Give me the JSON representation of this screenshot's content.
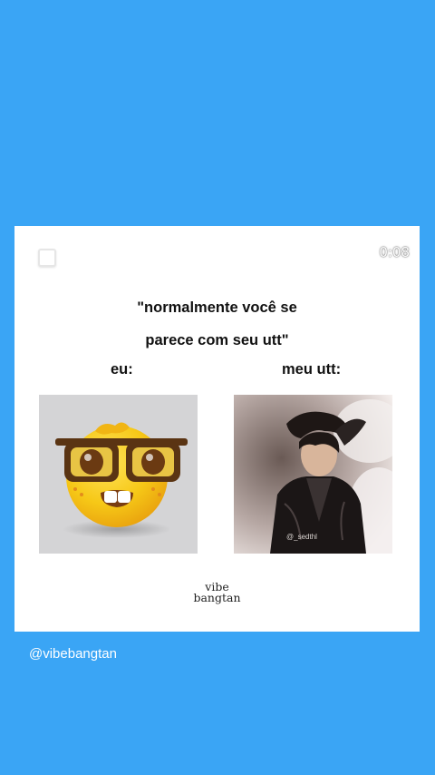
{
  "story": {
    "timer": "0:08",
    "handle": "@vibebangtan"
  },
  "post": {
    "quote_line1": "\"normalmente você se",
    "quote_line2": "parece com seu utt\"",
    "left_label": "eu:",
    "right_label": "meu utt:",
    "brand_line1": "vibe",
    "brand_line2": "bangtan",
    "left_image_icon": "nerd-face-emoji-icon",
    "right_image_description_icon": "person-photo-icon",
    "photo_credit": "@_sedthl"
  },
  "colors": {
    "background": "#3aa5f5",
    "card": "#ffffff",
    "emoji_yellow": "#f6c817",
    "glasses": "#5a3413"
  }
}
